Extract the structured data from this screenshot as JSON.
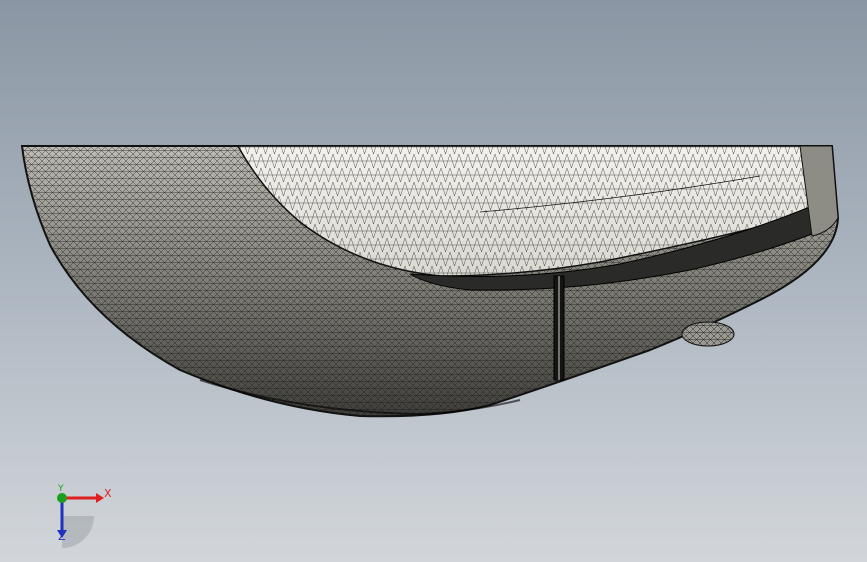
{
  "viewport": {
    "background_top": "#8a96a3",
    "background_bottom": "#d2d6da"
  },
  "model": {
    "render_mode": "wireframe-mesh",
    "shell_color": "#d6d4cc",
    "interior_color": "#ecebe6",
    "mesh_color": "#1a1a1a"
  },
  "triad": {
    "x_label": "X",
    "y_label": "Y",
    "z_label": "Z",
    "x_color": "#e02020",
    "y_color": "#1aa01a",
    "z_color": "#2030c0"
  }
}
